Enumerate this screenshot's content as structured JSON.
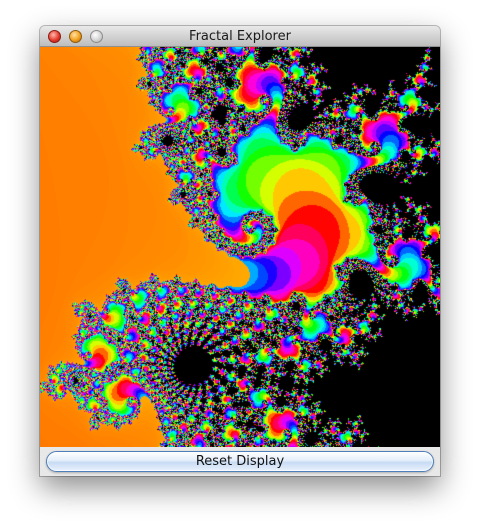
{
  "window": {
    "title": "Fractal Explorer"
  },
  "controls": {
    "reset_label": "Reset Display"
  },
  "icons": {
    "close": "close-icon",
    "minimize": "minimize-icon",
    "zoom": "zoom-icon"
  },
  "colors": {
    "escaped_fast": "#ff00cc",
    "boundary_orange": "#ff8800",
    "boundary_green": "#66ff33",
    "boundary_cyan": "#00ffff",
    "inside_set": "#000000"
  }
}
